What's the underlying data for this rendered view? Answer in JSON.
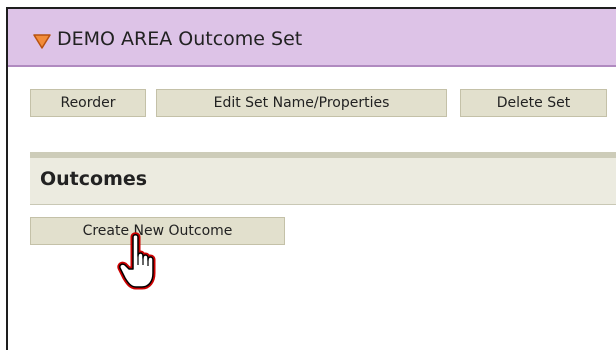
{
  "set_header": {
    "title": "DEMO AREA Outcome Set",
    "toggle_icon": "triangle-down-icon"
  },
  "toolbar": {
    "reorder_label": "Reorder",
    "edit_label": "Edit Set Name/Properties",
    "delete_label": "Delete Set"
  },
  "outcomes": {
    "title": "Outcomes",
    "create_label": "Create New Outcome"
  },
  "cursor": {
    "icon": "hand-pointer-icon"
  },
  "colors": {
    "header_bg": "#ddc3e7",
    "button_bg": "#e2e0cd",
    "section_bg": "#ecebe0",
    "toggle_fill": "#f28c3a",
    "cursor_outline": "#cc0000"
  }
}
